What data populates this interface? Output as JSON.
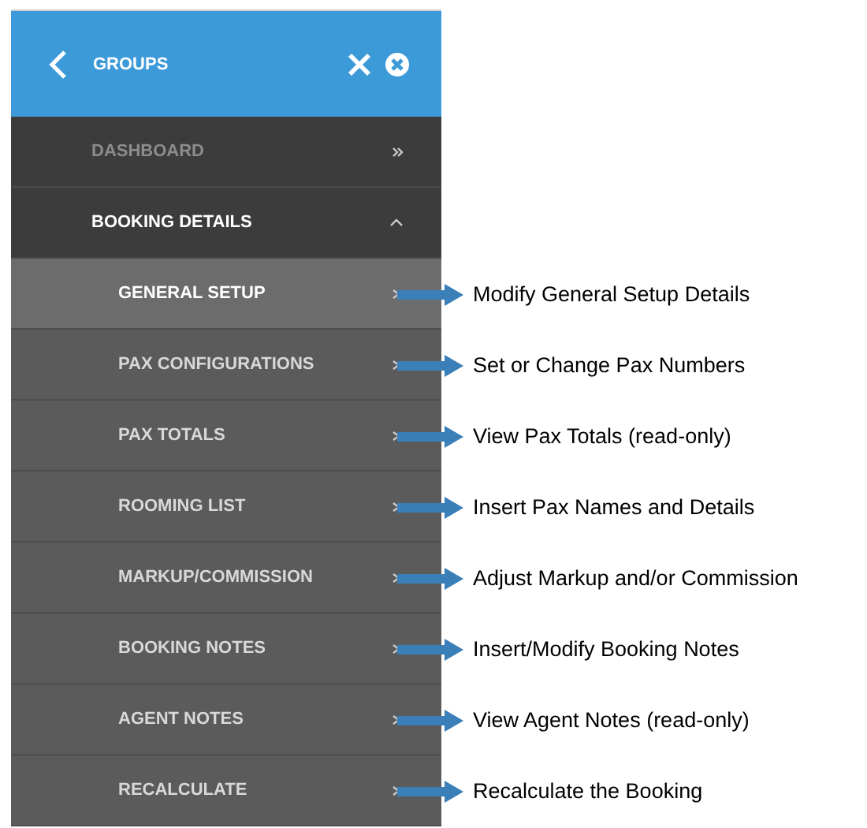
{
  "header": {
    "title": "GROUPS"
  },
  "menu": [
    {
      "label": "DASHBOARD",
      "disabled": true
    },
    {
      "label": "BOOKING DETAILS",
      "disabled": false,
      "expanded": true,
      "children": [
        {
          "label": "GENERAL SETUP",
          "selected": true,
          "callout": "Modify General Setup Details"
        },
        {
          "label": "PAX CONFIGURATIONS",
          "selected": false,
          "callout": "Set or Change Pax Numbers"
        },
        {
          "label": "PAX TOTALS",
          "selected": false,
          "callout": "View Pax Totals (read-only)"
        },
        {
          "label": "ROOMING LIST",
          "selected": false,
          "callout": "Insert Pax Names and Details"
        },
        {
          "label": "MARKUP/COMMISSION",
          "selected": false,
          "callout": "Adjust Markup and/or Commission"
        },
        {
          "label": "BOOKING NOTES",
          "selected": false,
          "callout": "Insert/Modify Booking Notes"
        },
        {
          "label": "AGENT NOTES",
          "selected": false,
          "callout": "View Agent Notes (read-only)"
        },
        {
          "label": "RECALCULATE",
          "selected": false,
          "callout": "Recalculate the Booking"
        }
      ]
    }
  ]
}
